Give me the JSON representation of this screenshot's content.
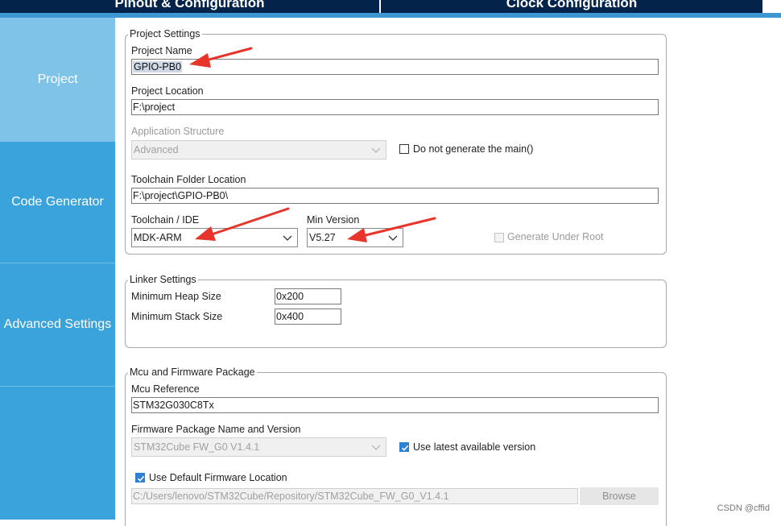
{
  "tabs": {
    "pinout": "Pinout & Configuration",
    "clock": "Clock Configuration"
  },
  "sidebar": {
    "items": [
      {
        "label": "Project",
        "active": true
      },
      {
        "label": "Code Generator",
        "active": false
      },
      {
        "label": "Advanced Settings",
        "active": false
      }
    ]
  },
  "project_settings": {
    "legend": "Project Settings",
    "name_label": "Project Name",
    "name_value": "GPIO-PB0",
    "location_label": "Project Location",
    "location_value": "F:\\project",
    "app_structure_label": "Application Structure",
    "app_structure_value": "Advanced",
    "no_main_label": "Do not generate the main()",
    "no_main_checked": false,
    "toolchain_folder_label": "Toolchain Folder Location",
    "toolchain_folder_value": "F:\\project\\GPIO-PB0\\",
    "toolchain_label": "Toolchain / IDE",
    "toolchain_value": "MDK-ARM",
    "min_version_label": "Min Version",
    "min_version_value": "V5.27",
    "gen_under_root_label": "Generate Under Root",
    "gen_under_root_checked": false
  },
  "linker_settings": {
    "legend": "Linker Settings",
    "heap_label": "Minimum Heap Size",
    "heap_value": "0x200",
    "stack_label": "Minimum Stack Size",
    "stack_value": "0x400"
  },
  "mcu_firmware": {
    "legend": "Mcu and Firmware Package",
    "mcu_ref_label": "Mcu Reference",
    "mcu_ref_value": "STM32G030C8Tx",
    "fw_name_label": "Firmware Package Name and Version",
    "fw_name_value": "STM32Cube FW_G0 V1.4.1",
    "use_latest_label": "Use latest available version",
    "use_latest_checked": true,
    "use_default_loc_label": "Use Default Firmware Location",
    "use_default_loc_checked": true,
    "fw_path_value": "C:/Users/lenovo/STM32Cube/Repository/STM32Cube_FW_G0_V1.4.1",
    "browse_label": "Browse"
  },
  "watermark": "CSDN @cffid",
  "colors": {
    "accent_dark": "#03234b",
    "sidebar": "#3aa3db",
    "sidebar_active": "#7fc4e8",
    "annotation_arrow": "#e8352b"
  }
}
